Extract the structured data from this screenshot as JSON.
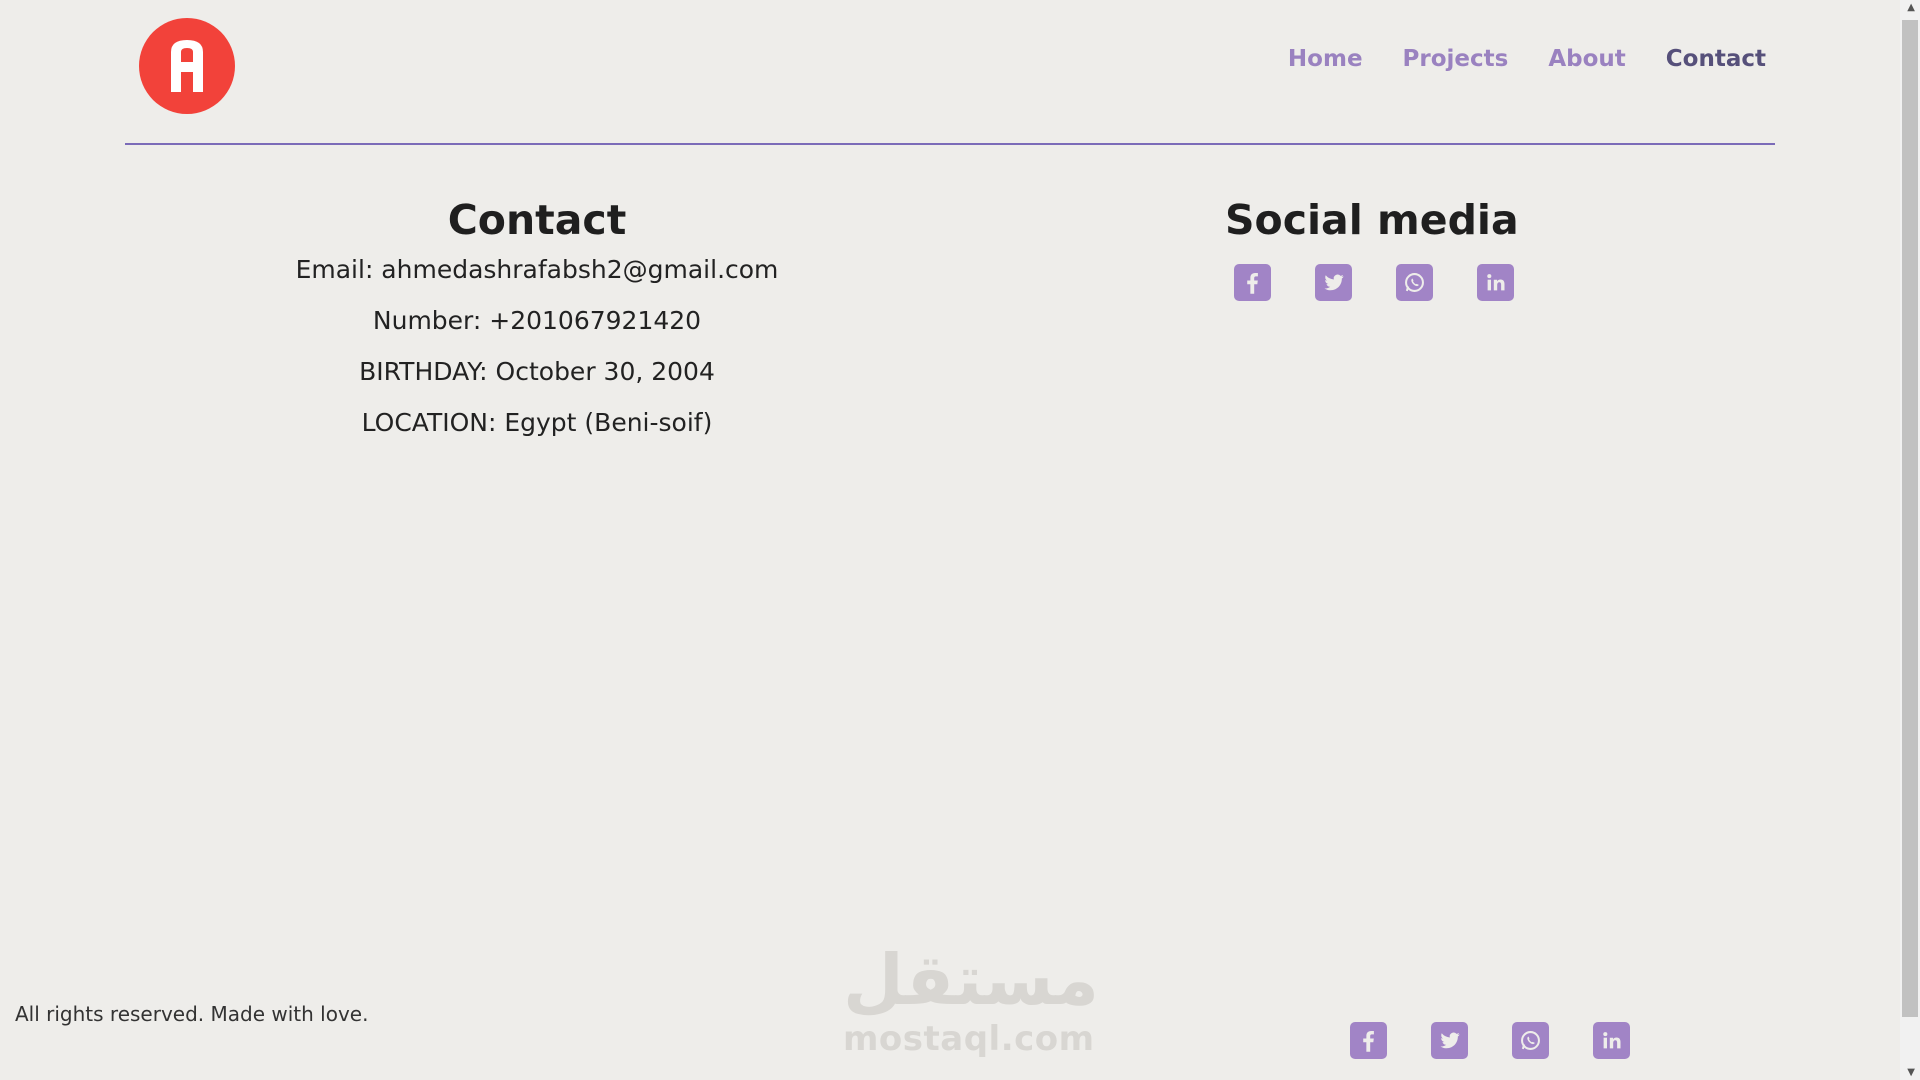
{
  "header": {
    "logo_letter": "A",
    "logo_color": "#f2423a",
    "nav": [
      {
        "label": "Home",
        "active": false
      },
      {
        "label": "Projects",
        "active": false
      },
      {
        "label": "About",
        "active": false
      },
      {
        "label": "Contact",
        "active": true
      }
    ],
    "nav_color": "#9a82c0",
    "nav_active_color": "#56507a"
  },
  "contact": {
    "title": "Contact",
    "email": "Email: ahmedashrafabsh2@gmail.com",
    "number": "Number: +201067921420",
    "birthday": "BIRTHDAY: October 30, 2004",
    "location": "LOCATION: Egypt (Beni-soif)"
  },
  "social": {
    "title": "Social media",
    "icons": [
      "facebook-icon",
      "twitter-icon",
      "whatsapp-icon",
      "linkedin-icon"
    ],
    "icon_color": "#a184c6"
  },
  "footer": {
    "text": "All rights reserved. Made with love.",
    "icons": [
      "facebook-icon",
      "twitter-icon",
      "whatsapp-icon",
      "linkedin-icon"
    ]
  },
  "watermark": {
    "arabic": "مستقل",
    "latin": "mostaql.com"
  }
}
